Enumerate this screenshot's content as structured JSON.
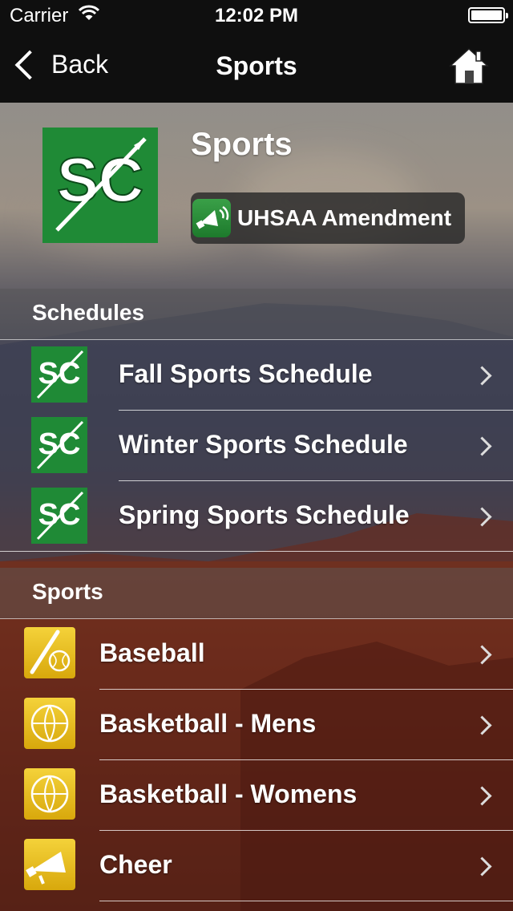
{
  "status": {
    "carrier": "Carrier",
    "time": "12:02 PM"
  },
  "nav": {
    "back_label": "Back",
    "title": "Sports"
  },
  "header": {
    "title": "Sports",
    "amendment_label": "UHSAA Amendment",
    "logo_text": "SC"
  },
  "schedules": {
    "heading": "Schedules",
    "items": [
      {
        "label": "Fall Sports Schedule"
      },
      {
        "label": "Winter Sports Schedule"
      },
      {
        "label": "Spring Sports Schedule"
      }
    ]
  },
  "sports": {
    "heading": "Sports",
    "items": [
      {
        "label": "Baseball",
        "icon": "baseball-icon"
      },
      {
        "label": "Basketball - Mens",
        "icon": "basketball-icon"
      },
      {
        "label": "Basketball - Womens",
        "icon": "basketball-icon"
      },
      {
        "label": "Cheer",
        "icon": "megaphone-icon"
      }
    ]
  },
  "colors": {
    "school_green": "#1f8a36",
    "sport_yellow": "#e8bf1c",
    "nav_bg": "#0f0f0f"
  }
}
